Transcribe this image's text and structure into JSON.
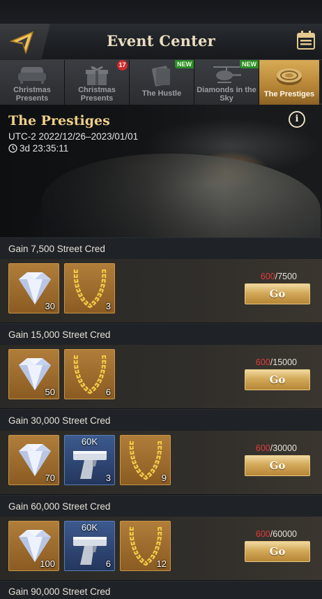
{
  "header": {
    "title": "Event Center"
  },
  "tabs": [
    {
      "label_1": "Christmas",
      "label_2": "Presents",
      "badge": ""
    },
    {
      "label_1": "Christmas",
      "label_2": "Presents",
      "badge": "17"
    },
    {
      "label_1": "The Hustle",
      "label_2": "",
      "badge": "NEW"
    },
    {
      "label_1": "Diamonds in the",
      "label_2": "Sky",
      "badge": "NEW"
    },
    {
      "label_1": "The Prestiges",
      "label_2": "",
      "badge": "",
      "active": true
    }
  ],
  "banner": {
    "title": "The Prestiges",
    "date_range": "UTC-2 2022/12/26–2023/01/01",
    "timer": "3d 23:35:11",
    "info_label": "i"
  },
  "tasks": [
    {
      "title": "Gain 7,500 Street Cred",
      "current": "600",
      "target": "/7500",
      "button": "Go",
      "rewards": [
        {
          "icon": "diamond-icon",
          "count": "30"
        },
        {
          "icon": "gold-chain-icon",
          "count": "3"
        }
      ]
    },
    {
      "title": "Gain 15,000 Street Cred",
      "current": "600",
      "target": "/15000",
      "button": "Go",
      "rewards": [
        {
          "icon": "diamond-icon",
          "count": "50"
        },
        {
          "icon": "gold-chain-icon",
          "count": "6"
        }
      ]
    },
    {
      "title": "Gain 30,000 Street Cred",
      "current": "600",
      "target": "/30000",
      "button": "Go",
      "rewards": [
        {
          "icon": "diamond-icon",
          "count": "70"
        },
        {
          "icon": "pistol-icon",
          "count": "3",
          "label": "60K"
        },
        {
          "icon": "gold-chain-icon",
          "count": "9"
        }
      ]
    },
    {
      "title": "Gain 60,000 Street Cred",
      "current": "600",
      "target": "/60000",
      "button": "Go",
      "rewards": [
        {
          "icon": "diamond-icon",
          "count": "100"
        },
        {
          "icon": "pistol-icon",
          "count": "6",
          "label": "60K"
        },
        {
          "icon": "gold-chain-icon",
          "count": "12"
        }
      ]
    },
    {
      "title": "Gain 90,000 Street Cred"
    }
  ],
  "colors": {
    "accent_gold": "#d3a95a",
    "progress_red": "#e23b3b",
    "reward_gold_bg": "#a0712f",
    "reward_blue_bg": "#304a78"
  }
}
